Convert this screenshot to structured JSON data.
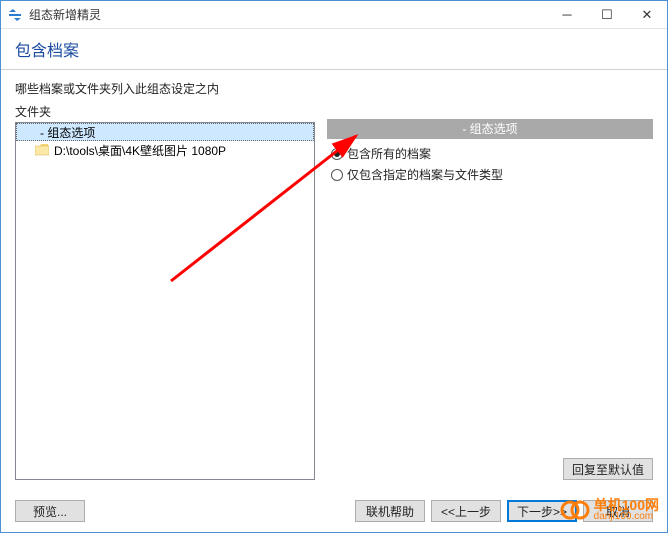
{
  "window": {
    "title": "组态新增精灵"
  },
  "header": {
    "title": "包含档案"
  },
  "prompt": "哪些档案或文件夹列入此组态设定之内",
  "left": {
    "label": "文件夹",
    "items": [
      {
        "label": "- 组态选项",
        "selected": true,
        "icon": "none"
      },
      {
        "label": "D:\\tools\\桌面\\4K壁纸图片 1080P",
        "selected": false,
        "icon": "folder"
      }
    ]
  },
  "right": {
    "section_title": "- 组态选项",
    "options": [
      {
        "label": "包含所有的档案",
        "checked": true
      },
      {
        "label": "仅包含指定的档案与文件类型",
        "checked": false
      }
    ],
    "reset_label": "回复至默认值"
  },
  "footer": {
    "preview": "预览...",
    "help": "联机帮助",
    "back": "<<上一步",
    "next": "下一步>>",
    "cancel": "取消"
  },
  "watermark": {
    "cn": "单机100网",
    "en": "danji100.com"
  }
}
